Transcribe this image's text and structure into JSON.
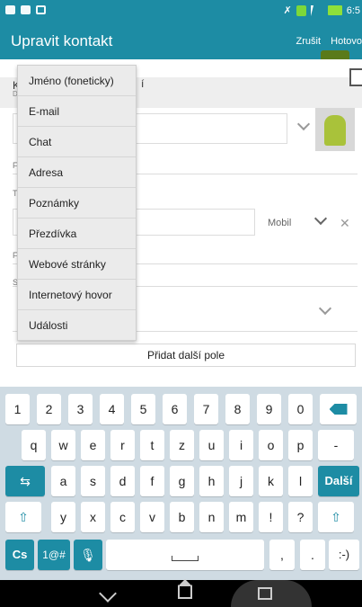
{
  "status_bar": {
    "time": "6:5"
  },
  "action_bar": {
    "title": "Upravit kontakt",
    "cancel": "Zrušit",
    "done": "Hotovo"
  },
  "form": {
    "name_row_prefix": "K",
    "name_row_sub": "D",
    "name_row_suffix": "í",
    "labels": [
      "F",
      "T",
      "F",
      "S"
    ],
    "phone_type": "Mobil",
    "add_field": "Přidat další pole"
  },
  "dropdown": {
    "items": [
      "Jméno (foneticky)",
      "E-mail",
      "Chat",
      "Adresa",
      "Poznámky",
      "Přezdívka",
      "Webové stránky",
      "Internetový hovor",
      "Události"
    ]
  },
  "keyboard": {
    "row1": [
      "1",
      "2",
      "3",
      "4",
      "5",
      "6",
      "7",
      "8",
      "9",
      "0"
    ],
    "row2": [
      "q",
      "w",
      "e",
      "r",
      "t",
      "z",
      "u",
      "i",
      "o",
      "p",
      "-"
    ],
    "row3": [
      "a",
      "s",
      "d",
      "f",
      "g",
      "h",
      "j",
      "k",
      "l"
    ],
    "enter_label": "Další",
    "row4": [
      "y",
      "x",
      "c",
      "v",
      "b",
      "n",
      "m",
      "!",
      "?"
    ],
    "lang": "Cs",
    "symbols": "1@#",
    "comma": ",",
    "period": ".",
    "smiley": ":-)"
  }
}
